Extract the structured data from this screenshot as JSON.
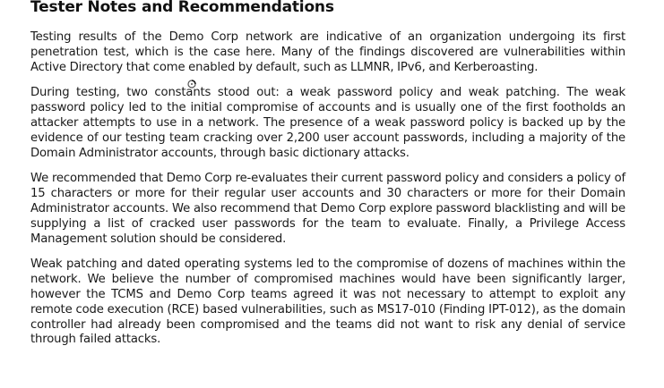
{
  "document": {
    "heading": "Tester Notes and Recommendations",
    "paragraphs": [
      "Testing results of the Demo Corp network are indicative of an organization undergoing its first penetration test, which is the case here. Many of the findings discovered are vulnerabilities within Active Directory that come enabled by default, such as LLMNR, IPv6, and Kerberoasting.",
      "During testing, two constants stood out: a weak password policy and weak patching. The weak password policy led to the initial compromise of accounts and is usually one of the first footholds an attacker attempts to use in a network. The presence of a weak password policy is backed up by the evidence of our testing team cracking over 2,200 user account passwords, including a majority of the Domain Administrator accounts, through basic dictionary attacks.",
      "We recommended that Demo Corp re-evaluates their current password policy and considers a policy of 15 characters or more for their regular user accounts and 30 characters or more for their Domain Administrator accounts. We also recommend that Demo Corp explore password blacklisting and will be supplying a list of cracked user passwords for the team to evaluate. Finally, a Privilege Access Management solution should be considered.",
      "Weak patching and dated operating systems led to the compromise of dozens of machines within the network.  We believe the number of compromised machines would have been significantly larger, however the TCMS and Demo Corp teams agreed it was not necessary to attempt to exploit any remote code execution (RCE) based vulnerabilities, such as MS17-010 (Finding IPT-012), as the domain controller had already been compromised and the teams did not want to risk any denial of service through failed attacks."
    ]
  },
  "cursor": {
    "icon": "busy-pointer-icon"
  }
}
